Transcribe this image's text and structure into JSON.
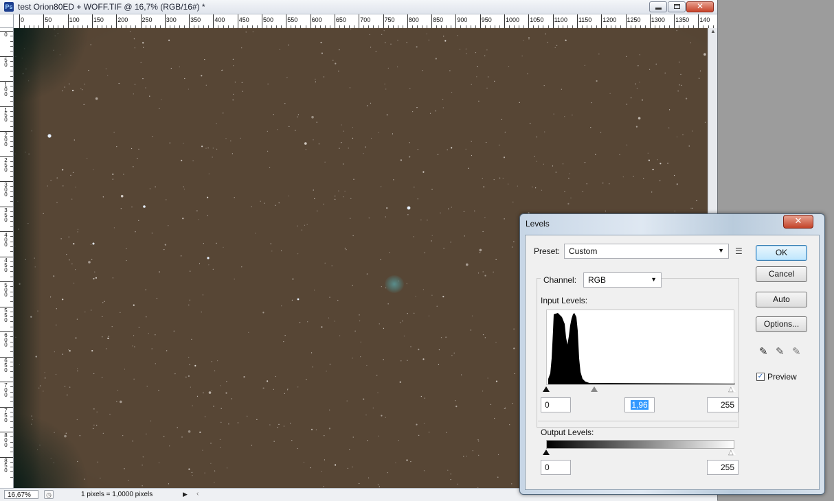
{
  "window": {
    "app_icon": "Ps",
    "title": "test Orion80ED + WOFF.TIF @ 16,7% (RGB/16#) *",
    "controls": {
      "minimize": "minimize-icon",
      "maximize": "maximize-icon",
      "close": "close-icon"
    }
  },
  "ruler": {
    "top_labels": [
      "0",
      "50",
      "100",
      "150",
      "200",
      "250",
      "300",
      "350",
      "400",
      "450",
      "500",
      "550",
      "600",
      "650",
      "700",
      "750",
      "800",
      "850",
      "900",
      "950",
      "1000",
      "1050",
      "1100",
      "1150",
      "1200",
      "1250",
      "1300",
      "1350",
      "140"
    ],
    "left_labels": [
      "0",
      "50",
      "100",
      "150",
      "200",
      "250",
      "300",
      "350",
      "400",
      "450",
      "500",
      "550",
      "600",
      "650",
      "700",
      "750",
      "800",
      "850"
    ]
  },
  "image": {
    "description_colors": {
      "sky": "#574635",
      "nebula": "#5a9696"
    }
  },
  "status": {
    "zoom": "16,67%",
    "info": "1 pixels = 1,0000 pixels"
  },
  "levels": {
    "title": "Levels",
    "preset_label": "Preset:",
    "preset_value": "Custom",
    "channel_label": "Channel:",
    "channel_value": "RGB",
    "input_levels_label": "Input Levels:",
    "input_black": "0",
    "input_gamma": "1,96",
    "input_white": "255",
    "output_levels_label": "Output Levels:",
    "output_black": "0",
    "output_white": "255",
    "buttons": {
      "ok": "OK",
      "cancel": "Cancel",
      "auto": "Auto",
      "options": "Options..."
    },
    "preview_label": "Preview",
    "preview_checked": true,
    "accent_color": "#3399ff"
  }
}
